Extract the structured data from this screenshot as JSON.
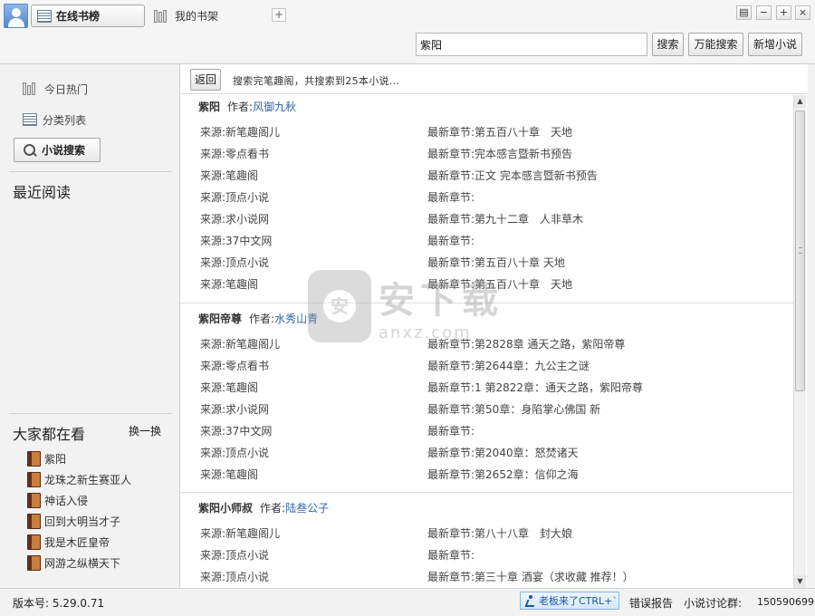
{
  "tabs": [
    {
      "label": "在线书榜"
    },
    {
      "label": "我的书架"
    }
  ],
  "add_tab": "+",
  "window_buttons": [
    "▤",
    "−",
    "+",
    "×"
  ],
  "search": {
    "value": "紫阳",
    "search_label": "搜索",
    "universal_label": "万能搜索",
    "add_novel_label": "新增小说"
  },
  "sidebar": {
    "today_hot": "今日热门",
    "category_list": "分类列表",
    "novel_search": "小说搜索",
    "recent_reading": "最近阅读",
    "watching_title": "大家都在看",
    "swap": "换一换",
    "hot_items": [
      "紫阳",
      "龙珠之新生赛亚人",
      "神话入侵",
      "回到大明当才子",
      "我是木匠皇帝",
      "网游之纵横天下"
    ]
  },
  "result_bar": {
    "back": "返回",
    "text": "搜索完笔趣阁，共搜索到25本小说..."
  },
  "labels": {
    "author": "作者:",
    "source": "来源:",
    "latest": "最新章节:"
  },
  "books": [
    {
      "name": "紫阳",
      "author": "风御九秋",
      "sources": [
        {
          "source": "新笔趣阁儿",
          "latest": "第五百八十章　天地"
        },
        {
          "source": "零点看书",
          "latest": "完本感言暨新书预告"
        },
        {
          "source": "笔趣阁",
          "latest": "正文 完本感言暨新书预告"
        },
        {
          "source": "顶点小说",
          "latest": ""
        },
        {
          "source": "求小说网",
          "latest": "第九十二章　人非草木"
        },
        {
          "source": "37中文网",
          "latest": ""
        },
        {
          "source": "顶点小说",
          "latest": "第五百八十章 天地"
        },
        {
          "source": "笔趣阁",
          "latest": "第五百八十章　天地"
        }
      ]
    },
    {
      "name": "紫阳帝尊",
      "author": "水秀山青",
      "sources": [
        {
          "source": "新笔趣阁儿",
          "latest": "第2828章 通天之路，紫阳帝尊"
        },
        {
          "source": "零点看书",
          "latest": "第2644章：九公主之谜"
        },
        {
          "source": "笔趣阁",
          "latest": "1 第2822章：通天之路，紫阳帝尊"
        },
        {
          "source": "求小说网",
          "latest": "第50章：身陷掌心佛国 新"
        },
        {
          "source": "37中文网",
          "latest": ""
        },
        {
          "source": "顶点小说",
          "latest": "第2040章：怒焚诸天"
        },
        {
          "source": "笔趣阁",
          "latest": "第2652章：信仰之海"
        }
      ]
    },
    {
      "name": "紫阳小师叔",
      "author": "陆叁公子",
      "sources": [
        {
          "source": "新笔趣阁儿",
          "latest": "第八十八章　封大娘"
        },
        {
          "source": "顶点小说",
          "latest": ""
        },
        {
          "source": "顶点小说",
          "latest": "第三十章 酒宴（求收藏 推荐！）"
        }
      ]
    }
  ],
  "watermark": {
    "cn": "安下载",
    "en": "anxz.com"
  },
  "status": {
    "version": "版本号: 5.29.0.71",
    "boss_button": "老板来了CTRL+`",
    "error_report": "错误报告",
    "group_label": "小说讨论群:",
    "group_number": "150590699"
  },
  "colors": {
    "author_link": "#2e63a8",
    "boss_button_text": "#1c55a8"
  },
  "icons": [
    "avatar-icon",
    "list-icon",
    "bookshelf-icon",
    "search-icon",
    "book-icon",
    "runner-icon"
  ]
}
